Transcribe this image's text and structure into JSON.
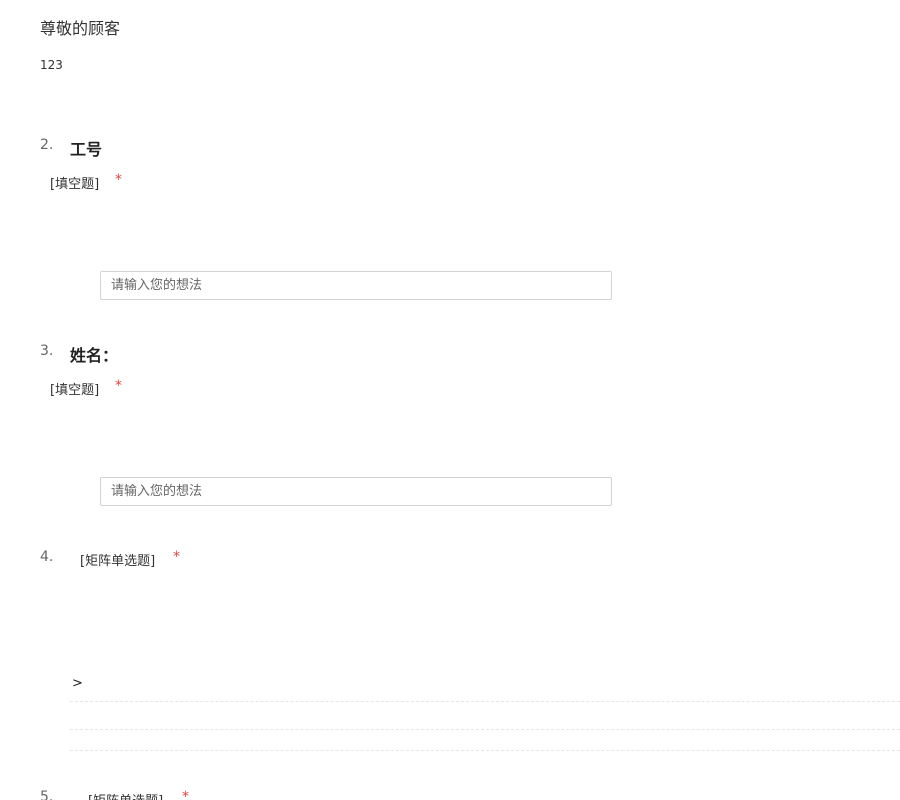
{
  "header": {
    "greeting": "尊敬的顾客",
    "intro": "123"
  },
  "questions": [
    {
      "number": "2.",
      "title": "工号",
      "type": "[填空题]",
      "required_mark": "*",
      "input_placeholder": "请输入您的想法"
    },
    {
      "number": "3.",
      "title": "姓名：",
      "type": "[填空题]",
      "required_mark": "*",
      "input_placeholder": "请输入您的想法"
    },
    {
      "number": "4.",
      "type": "[矩阵单选题]",
      "required_mark": "*",
      "row_marker": ">"
    },
    {
      "number": "5.",
      "type": "[矩阵单选题]",
      "required_mark": "*"
    }
  ],
  "colors": {
    "required": "#e64340",
    "input_border": "#d3d3d3",
    "divider": "#e6e6e6"
  }
}
